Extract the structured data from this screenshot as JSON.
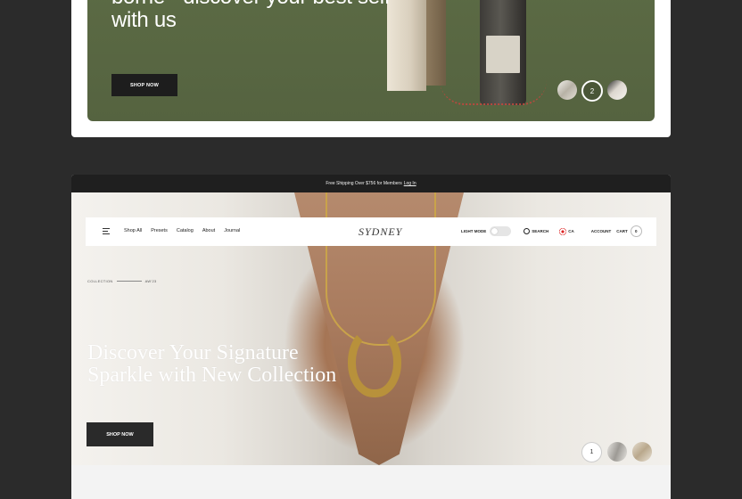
{
  "card1": {
    "hero_title": "borne - discover your best self with us",
    "shop_now": "SHOP NOW",
    "slider": [
      "",
      "2",
      ""
    ]
  },
  "card2": {
    "announcement": {
      "text": "Free Shipping Over $756 for Members",
      "login": "Log In"
    },
    "nav": {
      "links": [
        "Shop All",
        "Presets",
        "Catalog",
        "About",
        "Journal"
      ],
      "logo": "SYDNEY",
      "light_mode": "LIGHT MODE",
      "search": "SEARCH",
      "locale": "CA",
      "account": "ACCOUNT",
      "cart": "CART",
      "cart_count": "0"
    },
    "collection_label": "COLLECTION",
    "collection_season": "AW'23",
    "hero_title": "Discover Your Signature Sparkle with New Collection",
    "shop_now": "SHOP NOW",
    "slider": [
      "1",
      "",
      ""
    ]
  },
  "colors": {
    "olive": "#5b6a44",
    "dark": "#1f1f1f",
    "gold": "#c9a34a"
  },
  "icons": [
    "menu-icon",
    "search-icon",
    "ca-flag-icon"
  ]
}
